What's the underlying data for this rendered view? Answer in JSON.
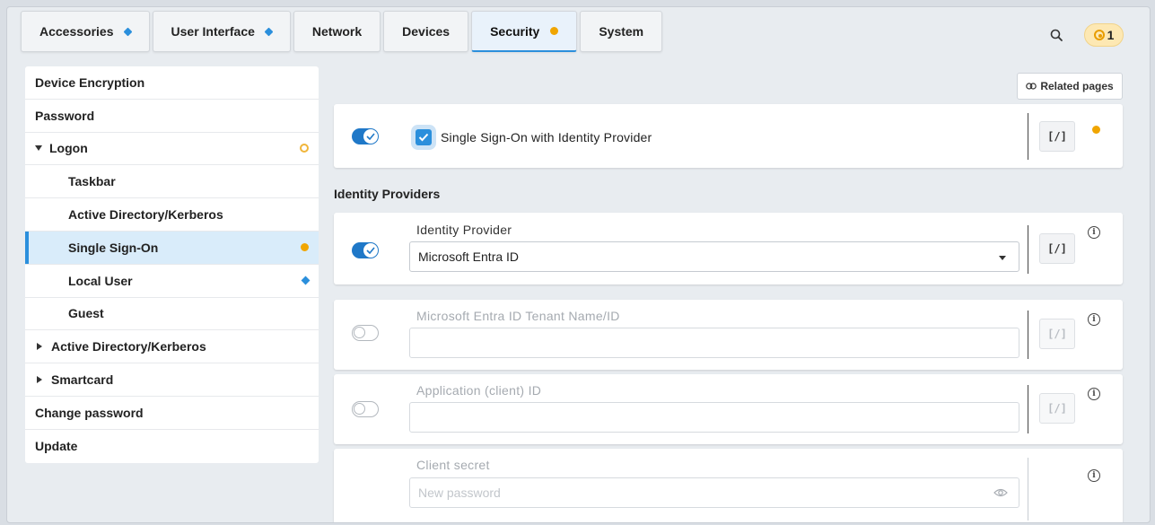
{
  "tabs": [
    {
      "label": "Accessories",
      "marker": "diamond"
    },
    {
      "label": "User Interface",
      "marker": "diamond"
    },
    {
      "label": "Network",
      "marker": ""
    },
    {
      "label": "Devices",
      "marker": ""
    },
    {
      "label": "Security",
      "marker": "dot",
      "active": true
    },
    {
      "label": "System",
      "marker": ""
    }
  ],
  "header": {
    "badge_count": "1"
  },
  "sidebar": {
    "items": [
      {
        "label": "Device Encryption"
      },
      {
        "label": "Password"
      },
      {
        "label": "Logon"
      },
      {
        "label": "Taskbar"
      },
      {
        "label": "Active Directory/Kerberos"
      },
      {
        "label": "Single Sign-On"
      },
      {
        "label": "Local User"
      },
      {
        "label": "Guest"
      },
      {
        "label": "Active Directory/Kerberos"
      },
      {
        "label": "Smartcard"
      },
      {
        "label": "Change password"
      },
      {
        "label": "Update"
      }
    ]
  },
  "main": {
    "related_pages": "Related pages",
    "sso_label": "Single Sign-On with Identity Provider",
    "section_title": "Identity Providers",
    "script_button": "[/]",
    "identity_provider": {
      "label": "Identity Provider",
      "value": "Microsoft Entra ID"
    },
    "tenant": {
      "label": "Microsoft Entra ID Tenant Name/ID",
      "value": ""
    },
    "app_id": {
      "label": "Application (client) ID",
      "value": ""
    },
    "client_secret": {
      "label": "Client secret",
      "placeholder": "New password"
    }
  },
  "colors": {
    "accent": "#2b8fdc",
    "warning": "#f0a500"
  }
}
